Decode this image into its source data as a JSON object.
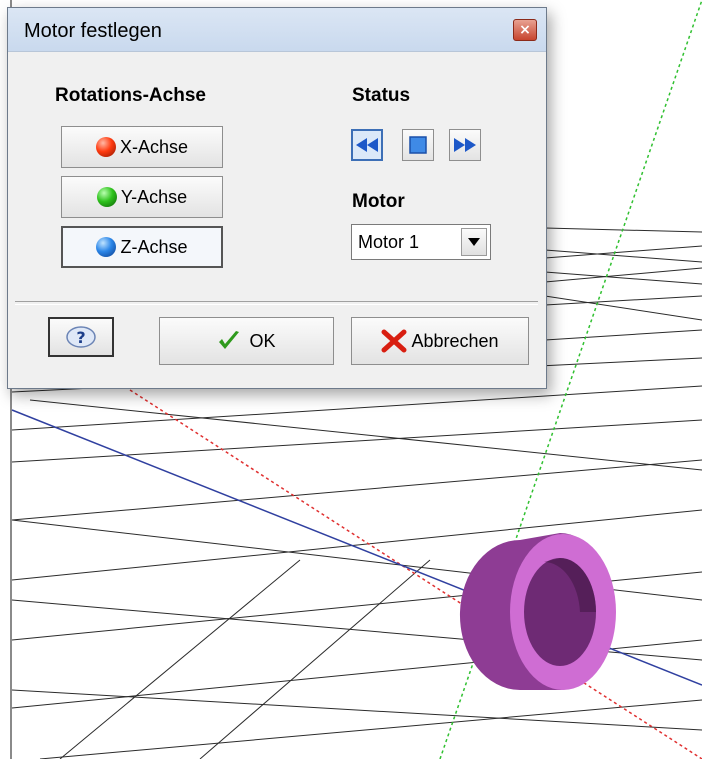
{
  "dialog": {
    "title": "Motor festlegen",
    "close_label": "×"
  },
  "rotation_axis": {
    "label": "Rotations-Achse",
    "buttons": [
      {
        "label": "X-Achse",
        "color": "#e8380d",
        "pressed": false
      },
      {
        "label": "Y-Achse",
        "color": "#2ca51c",
        "pressed": false
      },
      {
        "label": "Z-Achse",
        "color": "#2b73d6",
        "pressed": true
      }
    ]
  },
  "status": {
    "label": "Status",
    "buttons": [
      {
        "icon": "rewind-icon",
        "pressed": true
      },
      {
        "icon": "stop-icon",
        "pressed": false
      },
      {
        "icon": "fast-forward-icon",
        "pressed": false
      }
    ]
  },
  "motor": {
    "label": "Motor",
    "selected": "Motor 1"
  },
  "footer": {
    "help_icon": "question-mark-icon",
    "ok_label": "OK",
    "cancel_label": "Abbrechen"
  },
  "scene": {
    "object": "hollow-cylinder",
    "object_color": "#a24aa8",
    "axis_colors": {
      "x": "#e03030",
      "y": "#30c030",
      "z": "#3040a0"
    }
  }
}
